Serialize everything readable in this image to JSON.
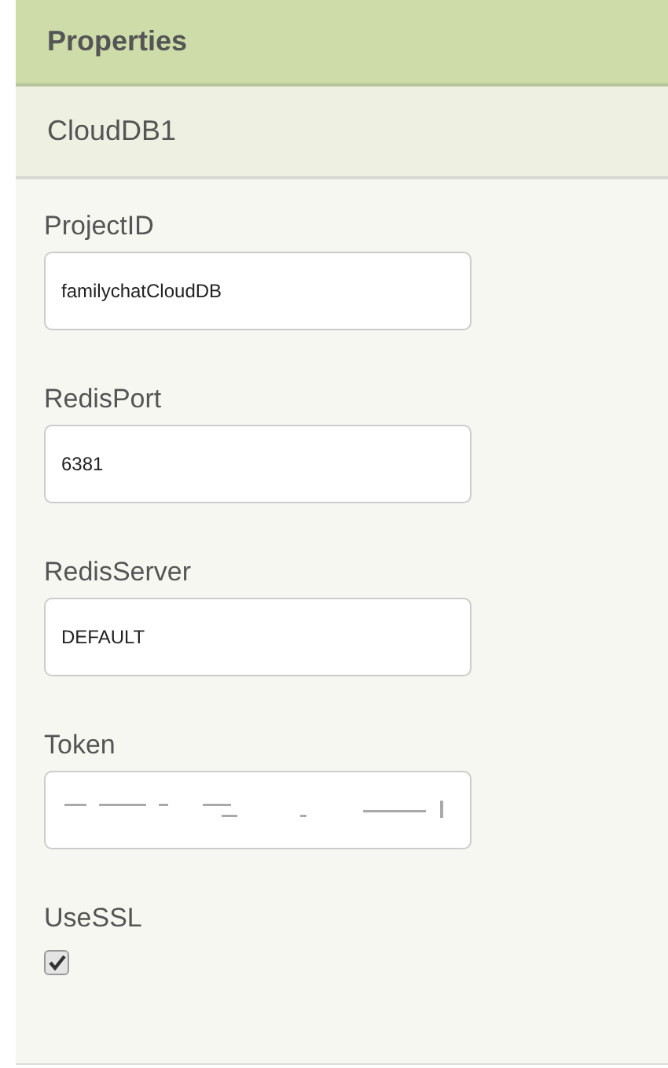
{
  "panel": {
    "title": "Properties"
  },
  "component": {
    "name": "CloudDB1"
  },
  "properties": [
    {
      "kind": "text",
      "label": "ProjectID",
      "value": "familychatCloudDB"
    },
    {
      "kind": "text",
      "label": "RedisPort",
      "value": "6381"
    },
    {
      "kind": "text",
      "label": "RedisServer",
      "value": "DEFAULT"
    },
    {
      "kind": "obscured",
      "label": "Token"
    },
    {
      "kind": "checkbox",
      "label": "UseSSL",
      "checked": true
    }
  ]
}
